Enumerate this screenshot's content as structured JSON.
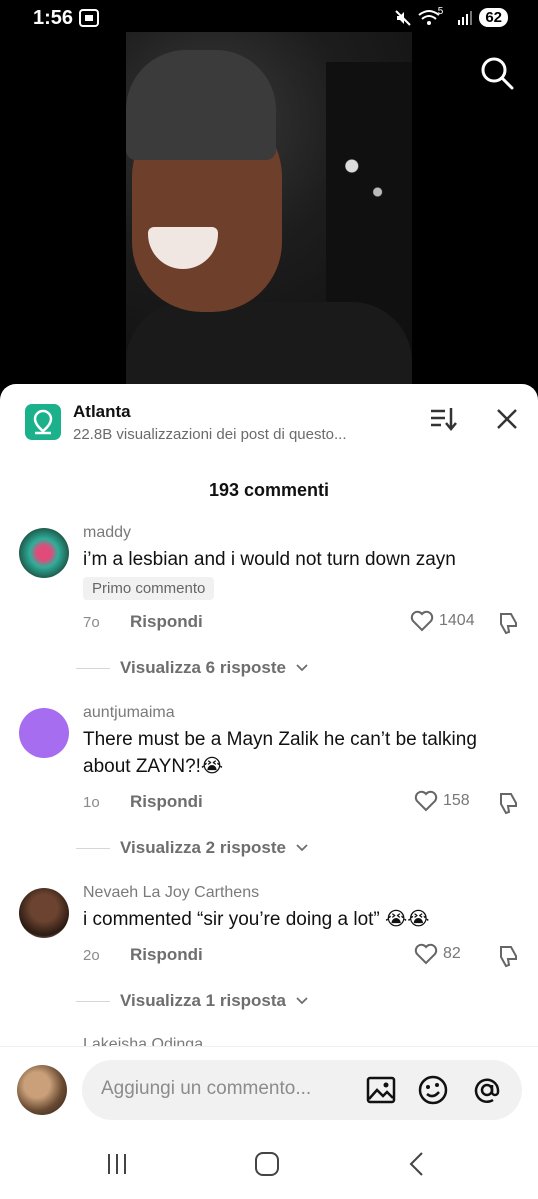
{
  "status": {
    "time": "1:56",
    "battery": "62",
    "signal_label": "5"
  },
  "location": {
    "title": "Atlanta",
    "subtitle": "22.8B visualizzazioni dei post di questo..."
  },
  "comments_header": "193 commenti",
  "comments": [
    {
      "username": "maddy",
      "text": "i’m a lesbian and i would not turn down zayn",
      "badge": "Primo commento",
      "time": "7o",
      "reply_label": "Rispondi",
      "likes": "1404",
      "view_replies": "Visualizza 6 risposte"
    },
    {
      "username": "auntjumaima",
      "text": "There must be a Mayn Zalik he can’t be talking about ZAYN?!😭",
      "time": "1o",
      "reply_label": "Rispondi",
      "likes": "158",
      "view_replies": "Visualizza 2 risposte"
    },
    {
      "username": "Nevaeh La Joy Carthens",
      "text": "i commented “sir you’re doing a lot” 😭😭",
      "time": "2o",
      "reply_label": "Rispondi",
      "likes": "82",
      "view_replies": "Visualizza 1 risposta"
    },
    {
      "username": "Lakeisha Odinga"
    }
  ],
  "input": {
    "placeholder": "Aggiungi un commento..."
  },
  "colors": {
    "location_icon": "#1bb18a",
    "avatar_purple": "#a66df0"
  }
}
